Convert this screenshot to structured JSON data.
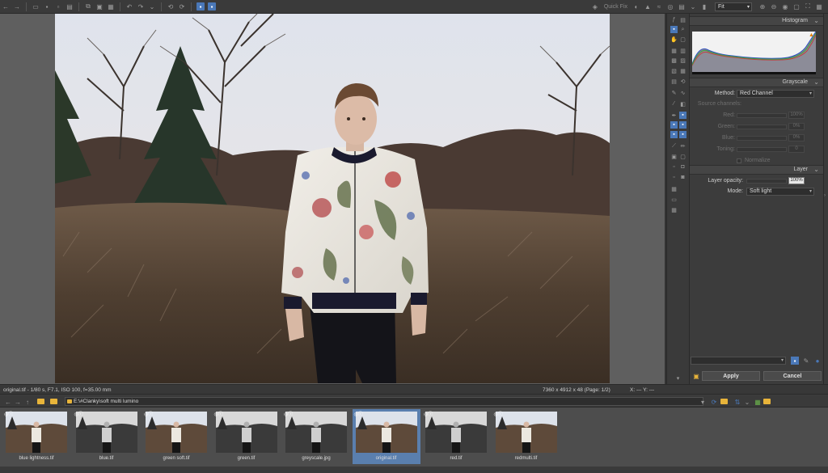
{
  "toolbar": {
    "quick_fix_label": "Quick Fix",
    "zoom_value": "Fit"
  },
  "histogram": {
    "title": "Histogram"
  },
  "grayscale": {
    "title": "Grayscale",
    "method_label": "Method:",
    "method_value": "Red Channel",
    "source_channels_label": "Source channels:",
    "sliders": [
      {
        "label": "Red:",
        "value": "100%"
      },
      {
        "label": "Green:",
        "value": "0%"
      },
      {
        "label": "Blue:",
        "value": "0%"
      },
      {
        "label": "Toning:",
        "value": "0"
      }
    ],
    "normalize_label": "Normalize"
  },
  "layer": {
    "title": "Layer",
    "opacity_label": "Layer opacity:",
    "opacity_value": "100%",
    "mode_label": "Mode:",
    "mode_value": "Soft light"
  },
  "actions": {
    "apply_label": "Apply",
    "cancel_label": "Cancel"
  },
  "status": {
    "exif": "original.tif - 1/80 s, F7.1, ISO 100, f=35.00 mm",
    "dimensions": "7360 x 4912 x 48 (Page: 1/2)",
    "coords": "X: --- Y: ---"
  },
  "browser": {
    "path": "E:\\#Clanky\\soft multi lumino"
  },
  "thumbnails": [
    {
      "name": "blue lightness.tif",
      "selected": false,
      "mono": false
    },
    {
      "name": "blue.tif",
      "selected": false,
      "mono": true
    },
    {
      "name": "green soft.tif",
      "selected": false,
      "mono": false
    },
    {
      "name": "green.tif",
      "selected": false,
      "mono": true
    },
    {
      "name": "greyscale.jpg",
      "selected": false,
      "mono": true
    },
    {
      "name": "original.tif",
      "selected": true,
      "mono": false
    },
    {
      "name": "red.tif",
      "selected": false,
      "mono": true
    },
    {
      "name": "redmulti.tif",
      "selected": false,
      "mono": false
    }
  ],
  "colors": {
    "accent": "#4a78b8",
    "selection": "#5a7fae",
    "folder": "#e8b43a"
  }
}
